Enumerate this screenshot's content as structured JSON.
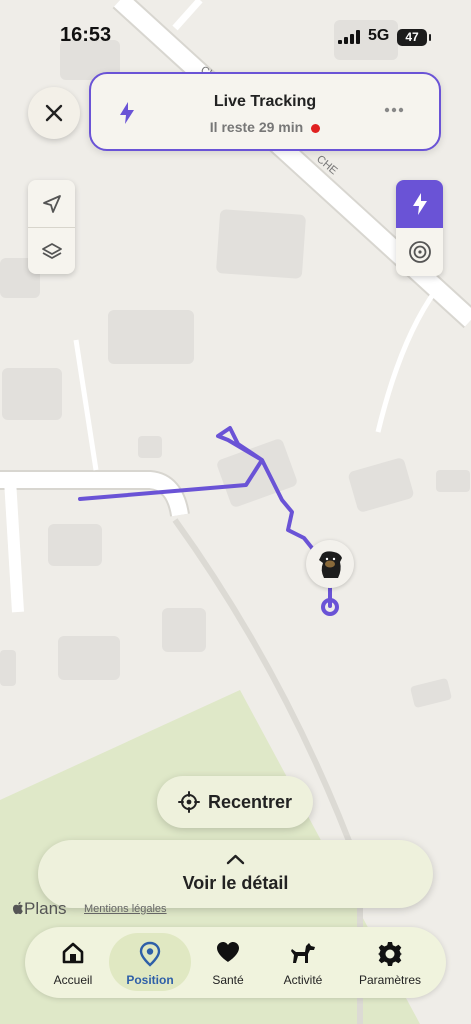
{
  "status_bar": {
    "time": "16:53",
    "network": "5G",
    "battery": "47"
  },
  "tracking": {
    "title": "Live Tracking",
    "subtitle": "Il reste 29 min"
  },
  "map": {
    "street_label_1": "CH",
    "street_label_2": "CHE",
    "attribution": "Plans",
    "legal_link": "Mentions légales"
  },
  "buttons": {
    "recenter": "Recentrer",
    "details": "Voir le détail"
  },
  "tabs": [
    {
      "label": "Accueil",
      "icon": "home-icon"
    },
    {
      "label": "Position",
      "icon": "location-pin-icon",
      "active": true
    },
    {
      "label": "Santé",
      "icon": "heart-icon"
    },
    {
      "label": "Activité",
      "icon": "dog-icon"
    },
    {
      "label": "Paramètres",
      "icon": "gear-icon"
    }
  ],
  "colors": {
    "accent": "#6a53d6",
    "recording": "#e02020",
    "park": "#dfe8c8",
    "tab_active": "#2e5fa8"
  }
}
